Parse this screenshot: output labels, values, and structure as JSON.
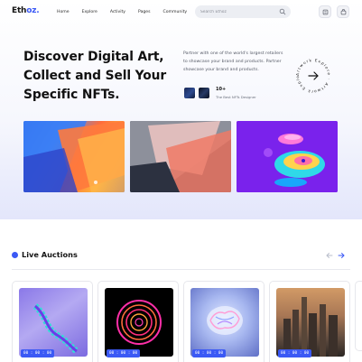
{
  "header": {
    "logo_main": "Eth",
    "logo_accent": "oz.",
    "nav": [
      "Home",
      "Explore",
      "Activity",
      "Pages",
      "Community"
    ],
    "search_placeholder": "Search Ethoz"
  },
  "hero": {
    "title": "Discover Digital Art, Collect and Sell Your Specific NFTs.",
    "description": "Partner with one of the world's largest retailers to showcase your brand and products. Partner showcase your brand and products.",
    "count": "10+",
    "count_label": "The Best NFTs Designer",
    "explore_ring_text": "Artwork Explore · Artwork Explore ·"
  },
  "live_auctions": {
    "title": "Live Auctions",
    "cards": [
      {
        "timer": "00 : 00 : 00"
      },
      {
        "timer": "00 : 00 : 00"
      },
      {
        "timer": "00 : 00 : 00"
      },
      {
        "timer": "00 : 00 : 00"
      }
    ]
  },
  "colors": {
    "accent": "#3b59f5",
    "text": "#141414",
    "muted": "#555a66"
  }
}
